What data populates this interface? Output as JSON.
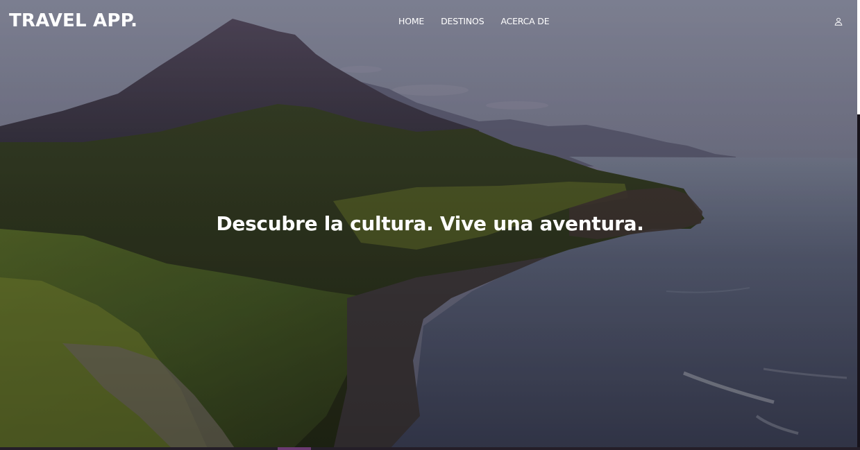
{
  "header": {
    "brand": "TRAVEL APP.",
    "nav": [
      {
        "label": "HOME"
      },
      {
        "label": "DESTINOS"
      },
      {
        "label": "ACERCA DE"
      }
    ],
    "user_icon": "user-icon"
  },
  "hero": {
    "headline": "Descubre la cultura. Vive una aventura.",
    "background": "coastal-mountain-landscape-photo"
  },
  "colors": {
    "text": "#ffffff",
    "overlay": "#1a1720"
  }
}
